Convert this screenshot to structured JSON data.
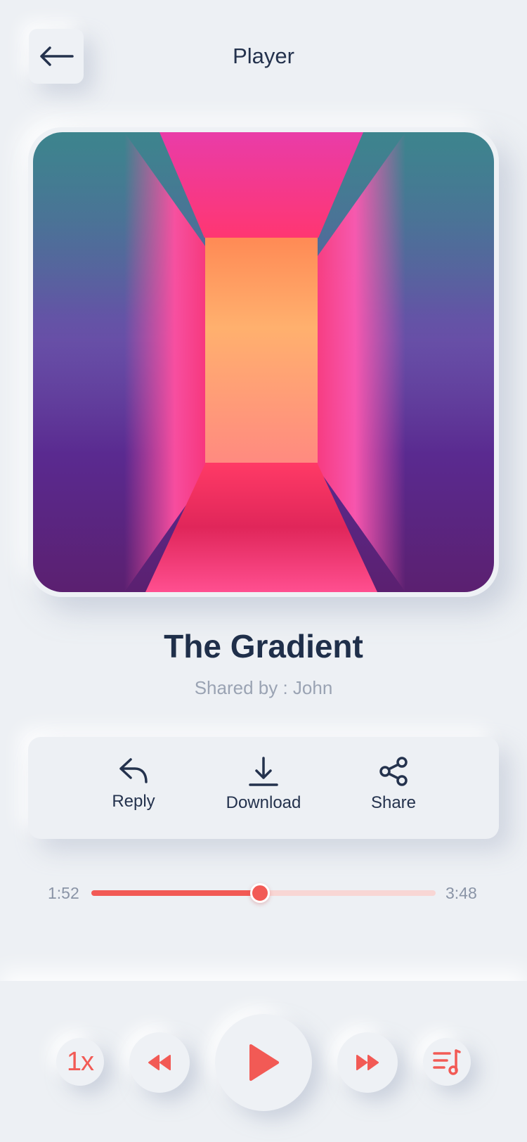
{
  "header": {
    "title": "Player",
    "back_icon": "arrow-left-icon"
  },
  "track": {
    "title": "The Gradient",
    "shared_by": "Shared by : John"
  },
  "actions": [
    {
      "label": "Reply",
      "icon": "reply-icon"
    },
    {
      "label": "Download",
      "icon": "download-icon"
    },
    {
      "label": "Share",
      "icon": "share-icon"
    }
  ],
  "progress": {
    "current": "1:52",
    "total": "3:48",
    "fraction": 0.49
  },
  "controls": {
    "speed": "1x",
    "speed_icon": "speed-icon",
    "rewind_icon": "rewind-icon",
    "play_icon": "play-icon",
    "forward_icon": "fast-forward-icon",
    "playlist_icon": "playlist-icon"
  },
  "colors": {
    "accent": "#f25a55",
    "background": "#edf0f4",
    "text": "#1f2f4a",
    "muted": "#9aa3b3"
  }
}
